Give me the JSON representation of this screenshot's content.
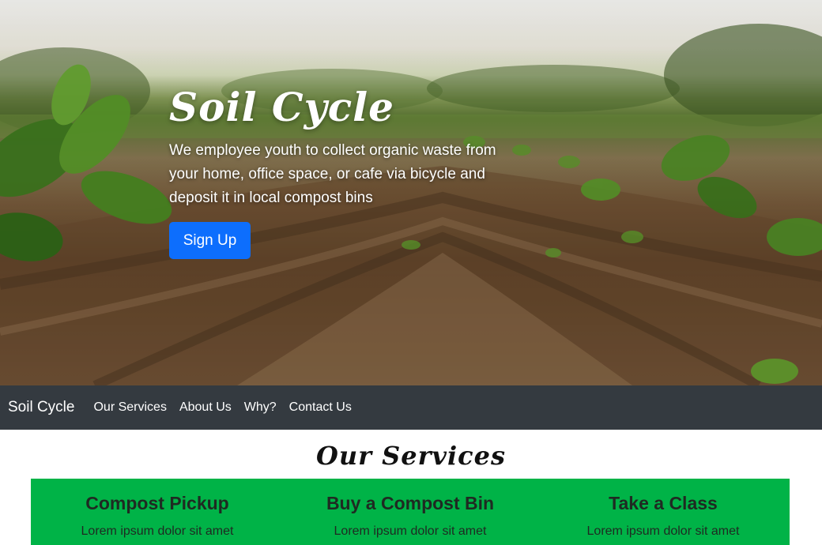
{
  "hero": {
    "title": "Soil Cycle",
    "description": "We employee youth to collect organic waste from your home, office space, or cafe via bicycle and deposit it in local compost bins",
    "button_label": "Sign Up"
  },
  "nav": {
    "brand": "Soil Cycle",
    "links": [
      "Our Services",
      "About Us",
      "Why?",
      "Contact Us"
    ]
  },
  "services": {
    "heading": "Our Services",
    "items": [
      {
        "title": "Compost Pickup",
        "text": "Lorem ipsum dolor sit amet"
      },
      {
        "title": "Buy a Compost Bin",
        "text": "Lorem ipsum dolor sit amet"
      },
      {
        "title": "Take a Class",
        "text": "Lorem ipsum dolor sit amet"
      }
    ],
    "band_color": "#00b347"
  },
  "colors": {
    "primary_button": "#0d6efd",
    "navbar_bg": "#343a40"
  }
}
